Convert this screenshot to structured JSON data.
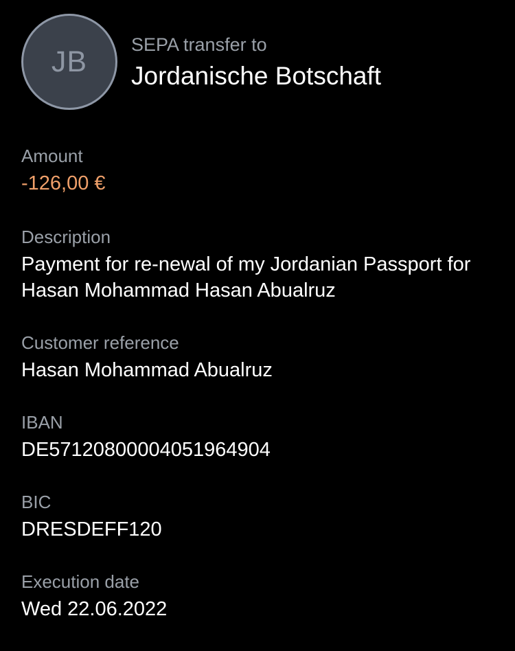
{
  "header": {
    "avatar_initials": "JB",
    "subtitle": "SEPA transfer to",
    "title": "Jordanische Botschaft"
  },
  "fields": {
    "amount": {
      "label": "Amount",
      "value": "-126,00 €"
    },
    "description": {
      "label": "Description",
      "value": "Payment for re-newal of my Jordanian Passport for Hasan Mohammad Hasan Abualruz"
    },
    "customer_reference": {
      "label": "Customer reference",
      "value": "Hasan Mohammad Abualruz"
    },
    "iban": {
      "label": "IBAN",
      "value": "DE57120800004051964904"
    },
    "bic": {
      "label": "BIC",
      "value": "DRESDEFF120"
    },
    "execution_date": {
      "label": "Execution date",
      "value": "Wed 22.06.2022"
    }
  },
  "colors": {
    "background": "#000000",
    "label": "#9aa0a8",
    "value": "#ffffff",
    "amount_negative": "#f0a06a",
    "avatar_fill": "#3b414b",
    "avatar_border": "#8e97a6"
  }
}
